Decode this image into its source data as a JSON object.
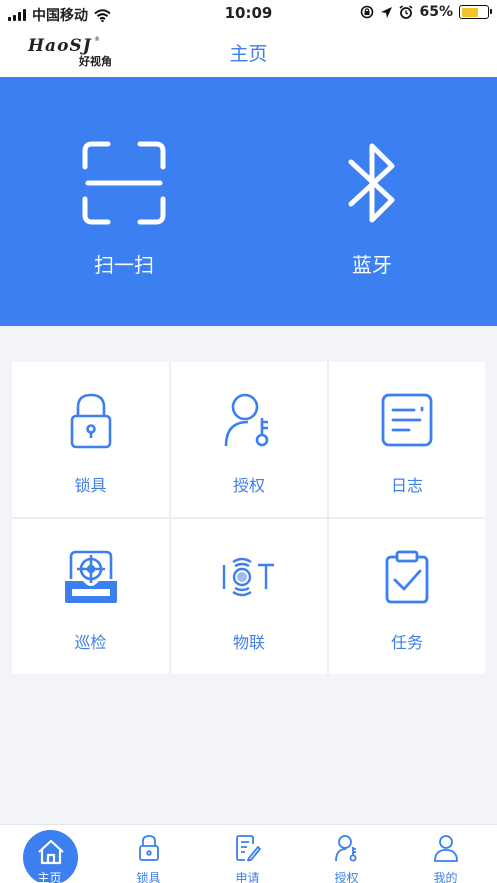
{
  "status_bar": {
    "carrier": "中国移动",
    "time": "10:09",
    "battery_percent": "65%",
    "battery_level": 0.65
  },
  "header": {
    "logo_text": "HaoSJ",
    "logo_subtitle": "好视角",
    "title": "主页"
  },
  "hero": {
    "scan_label": "扫一扫",
    "bluetooth_label": "蓝牙"
  },
  "grid": {
    "items": [
      {
        "label": "锁具",
        "icon": "lock-icon"
      },
      {
        "label": "授权",
        "icon": "user-key-icon"
      },
      {
        "label": "日志",
        "icon": "log-icon"
      },
      {
        "label": "巡检",
        "icon": "inspection-icon"
      },
      {
        "label": "物联",
        "icon": "iot-icon"
      },
      {
        "label": "任务",
        "icon": "task-icon"
      }
    ]
  },
  "tab_bar": {
    "tabs": [
      {
        "label": "主页",
        "icon": "home-icon"
      },
      {
        "label": "锁具",
        "icon": "lock-icon"
      },
      {
        "label": "申请",
        "icon": "apply-icon"
      },
      {
        "label": "授权",
        "icon": "user-key-icon"
      },
      {
        "label": "我的",
        "icon": "profile-icon"
      }
    ]
  },
  "colors": {
    "accent": "#3b7ff0",
    "text_accent": "#3f7fe6",
    "battery": "#f5c22a"
  }
}
